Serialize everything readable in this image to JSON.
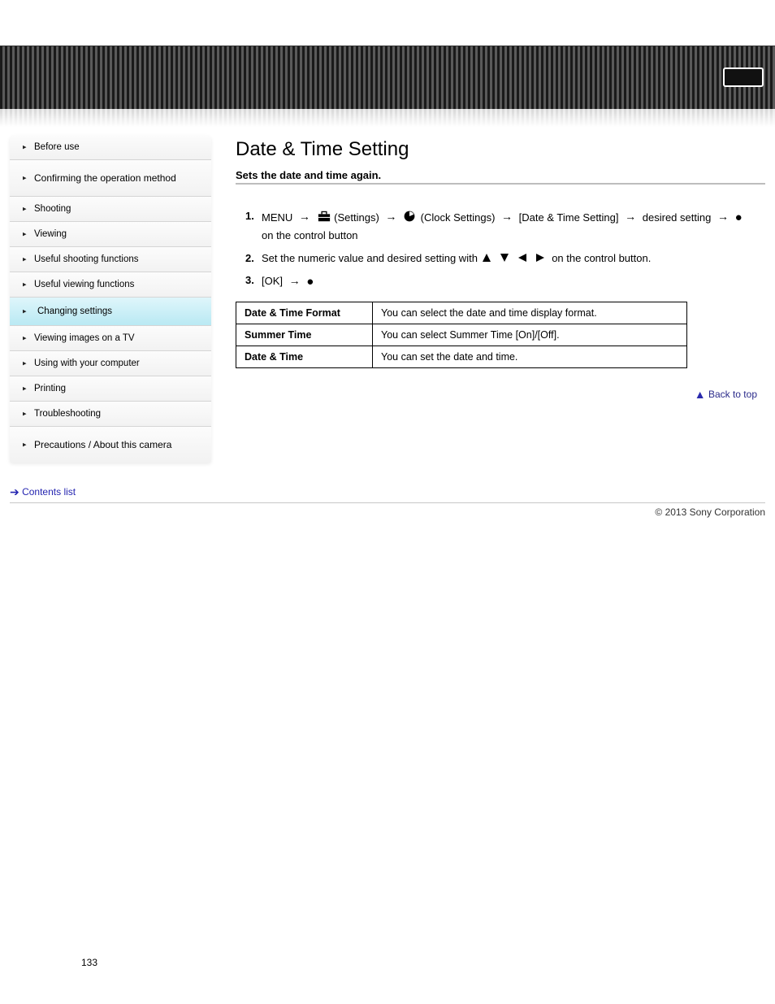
{
  "nav": [
    {
      "label": "Before use",
      "size": "small"
    },
    {
      "label": "Confirming the operation method",
      "size": "big"
    },
    {
      "label": "Shooting",
      "size": "small"
    },
    {
      "label": "Viewing",
      "size": "small"
    },
    {
      "label": "Useful shooting functions",
      "size": "small"
    },
    {
      "label": "Useful viewing functions",
      "size": "small"
    },
    {
      "label": "Changing settings",
      "size": "active"
    },
    {
      "label": "Viewing images on a TV",
      "size": "small"
    },
    {
      "label": "Using with your computer",
      "size": "small"
    },
    {
      "label": "Printing",
      "size": "small"
    },
    {
      "label": "Troubleshooting",
      "size": "small"
    },
    {
      "label": "Precautions / About this camera",
      "size": "big"
    }
  ],
  "contents_link": "Contents list",
  "page_title": "Date & Time Setting",
  "subtitle": "Sets the date and time again.",
  "step1": {
    "prefix": "MENU",
    "seg1": "(Settings)",
    "seg2": "(Clock Settings)",
    "seg3": "[Date & Time Setting]",
    "seg4": "desired setting",
    "btn": "on the control button"
  },
  "step2": {
    "seg1": "Set the numeric value and desired setting with",
    "seg2": "on the control button."
  },
  "step3": {
    "seg1": "[OK]"
  },
  "table": [
    {
      "k": "Date & Time Format",
      "v": "You can select the date and time display format."
    },
    {
      "k": "Summer Time",
      "v": "You can select Summer Time [On]/[Off]."
    },
    {
      "k": "Date & Time",
      "v": "You can set the date and time."
    }
  ],
  "backtop": "Back to top",
  "copyright": "© 2013 Sony Corporation",
  "page_number": "133"
}
